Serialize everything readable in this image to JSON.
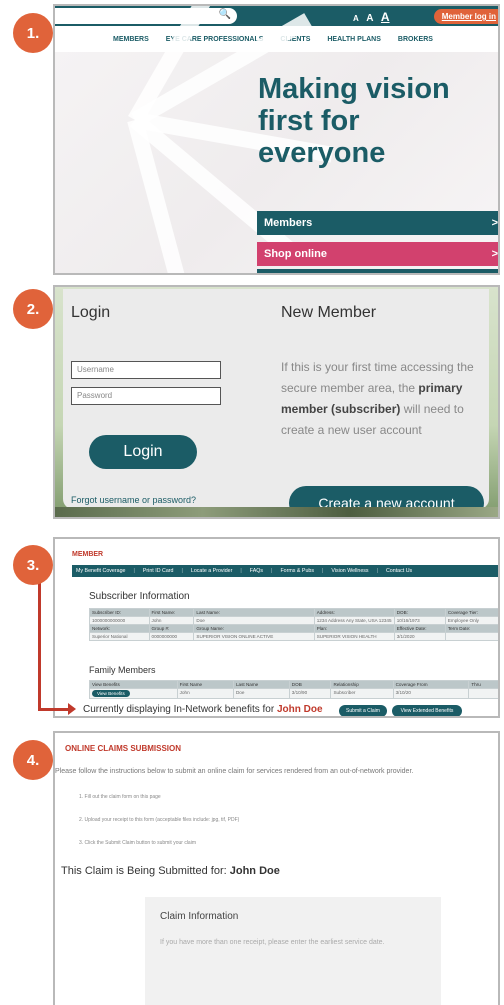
{
  "steps": [
    "1.",
    "2.",
    "3.",
    "4."
  ],
  "panel1": {
    "font_sizes": [
      "A",
      "A",
      "A"
    ],
    "member_login": "Member log in",
    "nav": [
      "MEMBERS",
      "EYE CARE PROFESSIONALS",
      "CLIENTS",
      "HEALTH PLANS",
      "BROKERS"
    ],
    "headline": [
      "Making vision",
      "first for",
      "everyone"
    ],
    "members_btn": "Members",
    "shop_btn": "Shop online",
    "chevron": ">"
  },
  "panel2": {
    "login_title": "Login",
    "username_placeholder": "Username",
    "password_placeholder": "Password",
    "login_btn": "Login",
    "forgot": "Forgot username or password?",
    "new_member_title": "New Member",
    "text_1": "If this is your first time accessing the secure member area, the",
    "text_bold": "primary member (subscriber)",
    "text_2": "will need to create a new user account",
    "create_btn": "Create a new account"
  },
  "panel3": {
    "title": "MEMBER",
    "nav": [
      "My Benefit Coverage",
      "Print ID Card",
      "Locate a Provider",
      "FAQs",
      "Forms & Pubs",
      "Vision Wellness",
      "Contact Us"
    ],
    "subscriber_title": "Subscriber Information",
    "sub_headers": [
      "Subscriber ID:",
      "First Name:",
      "Last Name:",
      "Address:",
      "DOB:",
      "Coverage Tier:"
    ],
    "sub_values": [
      "1000000000000",
      "John",
      "Doe",
      "1234 Address Any State, USA 12345",
      "10/16/1973",
      "Employee Only"
    ],
    "sub_headers2": [
      "Network:",
      "Group #:",
      "Group Name:",
      "Plan:",
      "Effective Date:",
      "Term Date:"
    ],
    "sub_values2": [
      "Superior National",
      "0000000000",
      "SUPERIOR VISION ONLINE ACTIVE",
      "SUPERIOR VISION HEALTH",
      "3/1/2020",
      ""
    ],
    "family_title": "Family Members",
    "fam_headers": [
      "View Benefits",
      "First Name",
      "Last Name",
      "DOB",
      "Relationship",
      "Coverage From",
      "Thru"
    ],
    "fam_values": [
      "View Benefits",
      "John",
      "Doe",
      "3/10/90",
      "Subscriber",
      "3/10/20",
      ""
    ],
    "displaying": "Currently displaying In-Network benefits for",
    "name": "John Doe",
    "submit_claim": "Submit a Claim",
    "view_extended": "View Extended Benefits"
  },
  "panel4": {
    "title": "ONLINE CLAIMS SUBMISSION",
    "intro": "Please follow the instructions below to submit an online claim for services rendered from an out-of-network provider.",
    "step1": "1. Fill out the claim form on this page",
    "step2": "2. Upload your receipt to this form (acceptable files include: jpg, tif, PDF)",
    "step3": "3. Click the Submit Claim button to submit your claim",
    "for_label": "This Claim is Being Submitted for:",
    "for_name": "John Doe",
    "box_title": "Claim Information",
    "box_text": "If you have more than one receipt, please enter the earliest service date."
  }
}
